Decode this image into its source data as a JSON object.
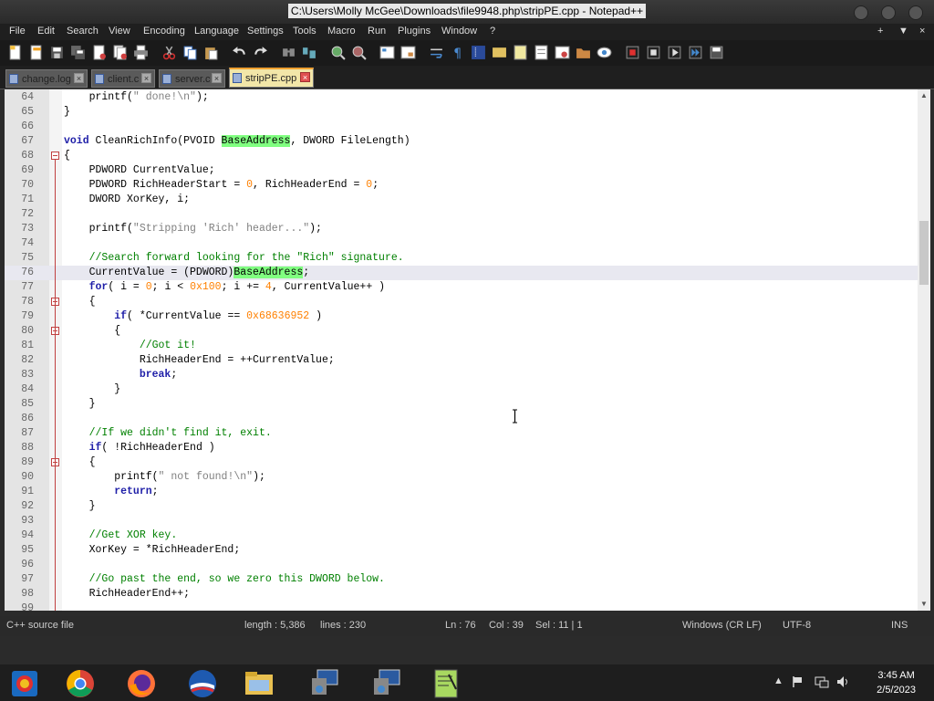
{
  "window": {
    "title": "C:\\Users\\Molly McGee\\Downloads\\file9948.php\\stripPE.cpp - Notepad++",
    "controls": [
      "minimize-button",
      "maximize-button",
      "close-button"
    ]
  },
  "menu": {
    "items": [
      "File",
      "Edit",
      "Search",
      "View",
      "Encoding",
      "Language",
      "Settings",
      "Tools",
      "Macro",
      "Run",
      "Plugins",
      "Window",
      "?"
    ],
    "right": [
      "+",
      "▼",
      "×"
    ]
  },
  "tabs": [
    {
      "label": "change.log",
      "active": false
    },
    {
      "label": "client.c",
      "active": false
    },
    {
      "label": "server.c",
      "active": false
    },
    {
      "label": "stripPE.cpp",
      "active": true
    }
  ],
  "editor": {
    "lines": [
      {
        "n": "64",
        "html": "    printf(<span class=\"str\">\" done!\\n\"</span>);"
      },
      {
        "n": "65",
        "html": "}"
      },
      {
        "n": "66",
        "html": ""
      },
      {
        "n": "67",
        "html": "<span class=\"kw\">void</span> CleanRichInfo(PVOID <span class=\"hl\">BaseAddress</span>, DWORD FileLength)"
      },
      {
        "n": "68",
        "html": "{"
      },
      {
        "n": "69",
        "html": "    PDWORD CurrentValue;"
      },
      {
        "n": "70",
        "html": "    PDWORD RichHeaderStart = <span class=\"num\">0</span>, RichHeaderEnd = <span class=\"num\">0</span>;"
      },
      {
        "n": "71",
        "html": "    DWORD XorKey, i;"
      },
      {
        "n": "72",
        "html": ""
      },
      {
        "n": "73",
        "html": "    printf(<span class=\"str\">\"Stripping 'Rich' header...\"</span>);"
      },
      {
        "n": "74",
        "html": ""
      },
      {
        "n": "75",
        "html": "    <span class=\"cmt\">//Search forward looking for the \"Rich\" signature.</span>"
      },
      {
        "n": "76",
        "html": "    CurrentValue = (PDWORD)<span class=\"hl\">BaseAddress</span>;"
      },
      {
        "n": "77",
        "html": "    <span class=\"kw\">for</span>( i = <span class=\"num\">0</span>; i &lt; <span class=\"hex\">0x100</span>; i += <span class=\"num\">4</span>, CurrentValue++ )"
      },
      {
        "n": "78",
        "html": "    {"
      },
      {
        "n": "79",
        "html": "        <span class=\"kw\">if</span>( *CurrentValue == <span class=\"hex\">0x68636952</span> )"
      },
      {
        "n": "80",
        "html": "        {"
      },
      {
        "n": "81",
        "html": "            <span class=\"cmt\">//Got it!</span>"
      },
      {
        "n": "82",
        "html": "            RichHeaderEnd = ++CurrentValue;"
      },
      {
        "n": "83",
        "html": "            <span class=\"kw\">break</span>;"
      },
      {
        "n": "84",
        "html": "        }"
      },
      {
        "n": "85",
        "html": "    }"
      },
      {
        "n": "86",
        "html": ""
      },
      {
        "n": "87",
        "html": "    <span class=\"cmt\">//If we didn't find it, exit.</span>"
      },
      {
        "n": "88",
        "html": "    <span class=\"kw\">if</span>( !RichHeaderEnd )"
      },
      {
        "n": "89",
        "html": "    {"
      },
      {
        "n": "90",
        "html": "        printf(<span class=\"str\">\" not found!\\n\"</span>);"
      },
      {
        "n": "91",
        "html": "        <span class=\"kw\">return</span>;"
      },
      {
        "n": "92",
        "html": "    }"
      },
      {
        "n": "93",
        "html": ""
      },
      {
        "n": "94",
        "html": "    <span class=\"cmt\">//Get XOR key.</span>"
      },
      {
        "n": "95",
        "html": "    XorKey = *RichHeaderEnd;"
      },
      {
        "n": "96",
        "html": ""
      },
      {
        "n": "97",
        "html": "    <span class=\"cmt\">//Go past the end, so we zero this DWORD below.</span>"
      },
      {
        "n": "98",
        "html": "    RichHeaderEnd++;"
      },
      {
        "n": "99",
        "html": ""
      }
    ],
    "current_line": "76",
    "fold_lines": [
      "68",
      "78",
      "80",
      "89"
    ]
  },
  "status": {
    "language": "C++ source file",
    "length": "length : 5,386",
    "lines": "lines : 230",
    "ln": "Ln : 76",
    "col": "Col : 39",
    "sel": "Sel : 11 | 1",
    "eol": "Windows (CR LF)",
    "encoding": "UTF-8",
    "mode": "INS"
  },
  "taskbar": {
    "apps": [
      "notepad-icon-app",
      "chrome-icon",
      "firefox-icon",
      "opera-icon",
      "file-explorer-icon",
      "remote-desktop-icon",
      "remote-desktop-icon-2",
      "notepadpp-icon"
    ],
    "clock_time": "3:45 AM",
    "clock_date": "2/5/2023"
  },
  "colors": {
    "highlight": "#80ff80",
    "keyword": "#1f1fa8",
    "number": "#ff8000",
    "comment": "#008000",
    "string": "#808080"
  }
}
